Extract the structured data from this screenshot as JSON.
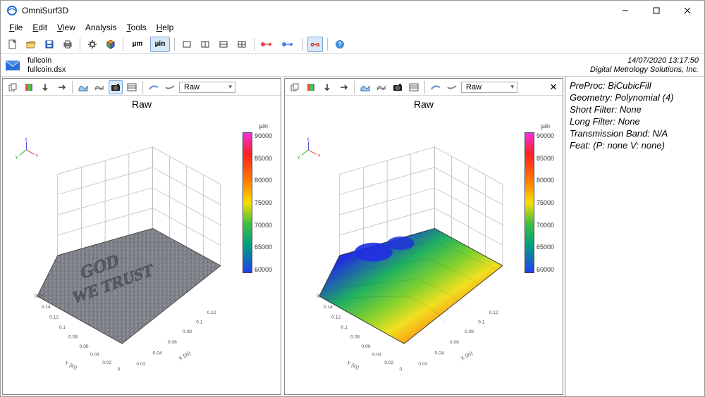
{
  "window": {
    "title": "OmniSurf3D"
  },
  "menu": {
    "file": "File",
    "edit": "Edit",
    "view": "View",
    "analysis": "Analysis",
    "tools": "Tools",
    "help": "Help"
  },
  "toolbar": {
    "unit_um": "µm",
    "unit_uin": "µin"
  },
  "fileinfo": {
    "name": "fullcoin",
    "filename": "fullcoin.dsx",
    "timestamp": "14/07/2020  13:17:50",
    "vendor": "Digital Metrology Solutions, Inc."
  },
  "view_left": {
    "dropdown": "Raw",
    "title": "Raw",
    "colorbar_unit": "µin",
    "ticks": [
      "90000",
      "85000",
      "80000",
      "75000",
      "70000",
      "65000",
      "60000"
    ],
    "xlabel": "X (in)",
    "ylabel": "Y (in)",
    "surface_text": "GOD WE TRUST"
  },
  "view_right": {
    "dropdown": "Raw",
    "title": "Raw",
    "colorbar_unit": "µin",
    "ticks": [
      "90000",
      "85000",
      "80000",
      "75000",
      "70000",
      "65000",
      "60000"
    ],
    "xlabel": "X (in)",
    "ylabel": "Y (in)"
  },
  "sidepanel": {
    "preproc_label": "PreProc:",
    "preproc_value": "BiCubicFill",
    "geometry_label": "Geometry:",
    "geometry_value": "Polynomial (4)",
    "shortfilter_label": "Short Filter:",
    "shortfilter_value": "None",
    "longfilter_label": "Long Filter:",
    "longfilter_value": "None",
    "band_label": "Transmission Band:",
    "band_value": "N/A",
    "feat_label": "Feat:",
    "feat_value": "(P: none   V: none)"
  },
  "chart_data": [
    {
      "type": "heatmap",
      "title": "Raw",
      "zlabel": "µin",
      "xlabel": "X (in)",
      "ylabel": "Y (in)",
      "xlim": [
        0,
        0.18
      ],
      "ylim": [
        0,
        0.16
      ],
      "zlim": [
        60000,
        90000
      ],
      "rendering": "photo-texture",
      "note": "3D surface of coin area showing engraved text 'GOD / WE TRUST'; height values mapped to rainbow colorbar 60000–90000 µin"
    },
    {
      "type": "heatmap",
      "title": "Raw",
      "zlabel": "µin",
      "xlabel": "X (in)",
      "ylabel": "Y (in)",
      "xlim": [
        0,
        0.18
      ],
      "ylim": [
        0,
        0.16
      ],
      "zlim": [
        60000,
        90000
      ],
      "rendering": "height-colormap",
      "note": "Same surface rendered with rainbow height colormap; upper-left region low (blue ~60000), lower-right high (red/magenta ~90000), diagonal gradient"
    }
  ]
}
